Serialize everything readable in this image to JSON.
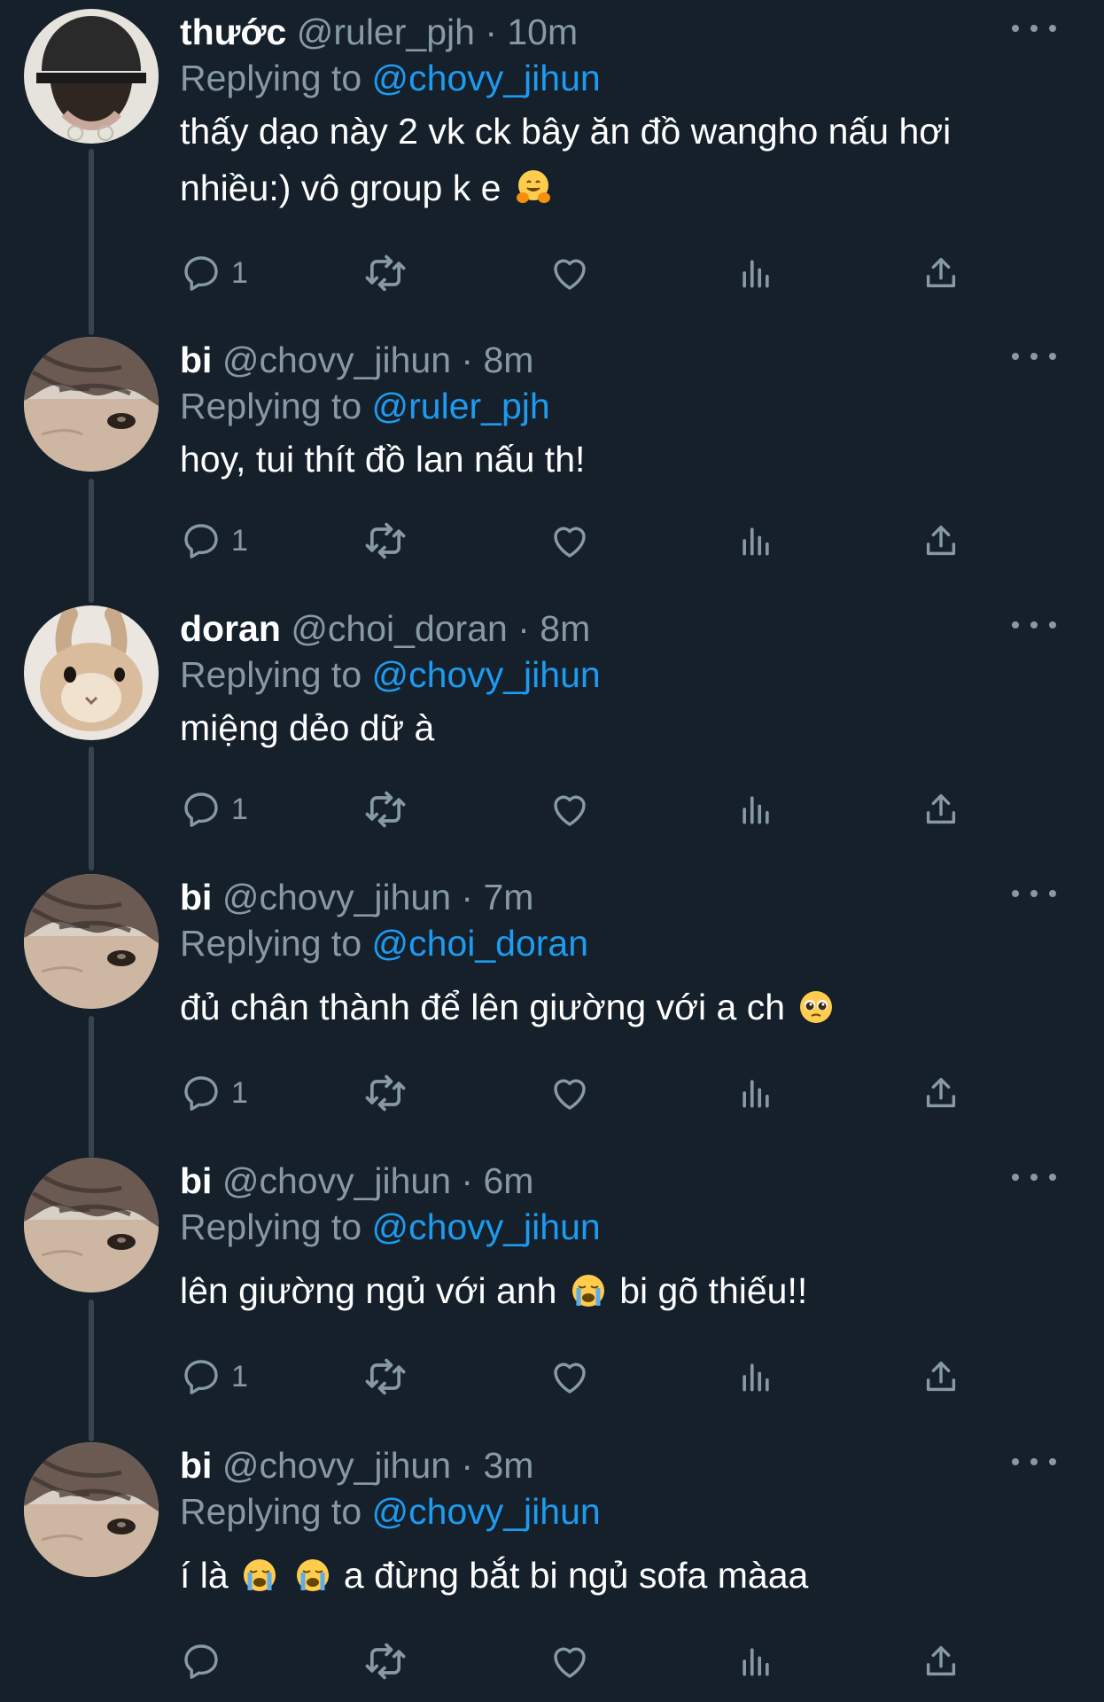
{
  "tweets": [
    {
      "name": "thước",
      "handle": "@ruler_pjh",
      "time": "· 10m",
      "replying_label": "Replying to",
      "replying_to": "@chovy_jihun",
      "text_lines": [
        "thấy dạo này 2 vk ck bây ăn đồ wangho nấu hơi",
        "nhiều:) vô group k e"
      ],
      "text_emoji": "hugging-face",
      "reply_count": "1",
      "avatar": "dark-hat-person"
    },
    {
      "name": "bi",
      "handle": "@chovy_jihun",
      "time": "· 8m",
      "replying_label": "Replying to",
      "replying_to": "@ruler_pjh",
      "text": "hoy, tui thít đồ lan nấu th!",
      "reply_count": "1",
      "avatar": "bangs-eye-closeup"
    },
    {
      "name": "doran",
      "handle": "@choi_doran",
      "time": "· 8m",
      "replying_label": "Replying to",
      "replying_to": "@chovy_jihun",
      "text": "miệng dẻo dữ à",
      "reply_count": "1",
      "avatar": "bunny"
    },
    {
      "name": "bi",
      "handle": "@chovy_jihun",
      "time": "· 7m",
      "replying_label": "Replying to",
      "replying_to": "@choi_doran",
      "text": "đủ chân thành để lên giường với a ch",
      "text_emoji": "pleading-face",
      "reply_count": "1",
      "avatar": "bangs-eye-closeup"
    },
    {
      "name": "bi",
      "handle": "@chovy_jihun",
      "time": "· 6m",
      "replying_label": "Replying to",
      "replying_to": "@chovy_jihun",
      "text_before": "lên giường ngủ với anh",
      "text_emoji": "loudly-crying-face",
      "text_after": "bi gõ thiếu!!",
      "reply_count": "1",
      "avatar": "bangs-eye-closeup"
    },
    {
      "name": "bi",
      "handle": "@chovy_jihun",
      "time": "· 3m",
      "replying_label": "Replying to",
      "replying_to": "@chovy_jihun",
      "text_before": "í là",
      "text_emoji": "loudly-crying-face",
      "text_after": "a đừng bắt bi ngủ sofa màaa",
      "reply_count": "",
      "avatar": "bangs-eye-closeup"
    }
  ],
  "icons": {
    "reply": "reply-icon",
    "retweet": "retweet-icon",
    "like": "like-icon",
    "analytics": "analytics-icon",
    "share": "share-icon",
    "more": "more-icon"
  },
  "colors": {
    "background": "#15202b",
    "secondary_text": "#8899a6",
    "mention": "#1d9bf0",
    "thread_line": "#38444d"
  }
}
